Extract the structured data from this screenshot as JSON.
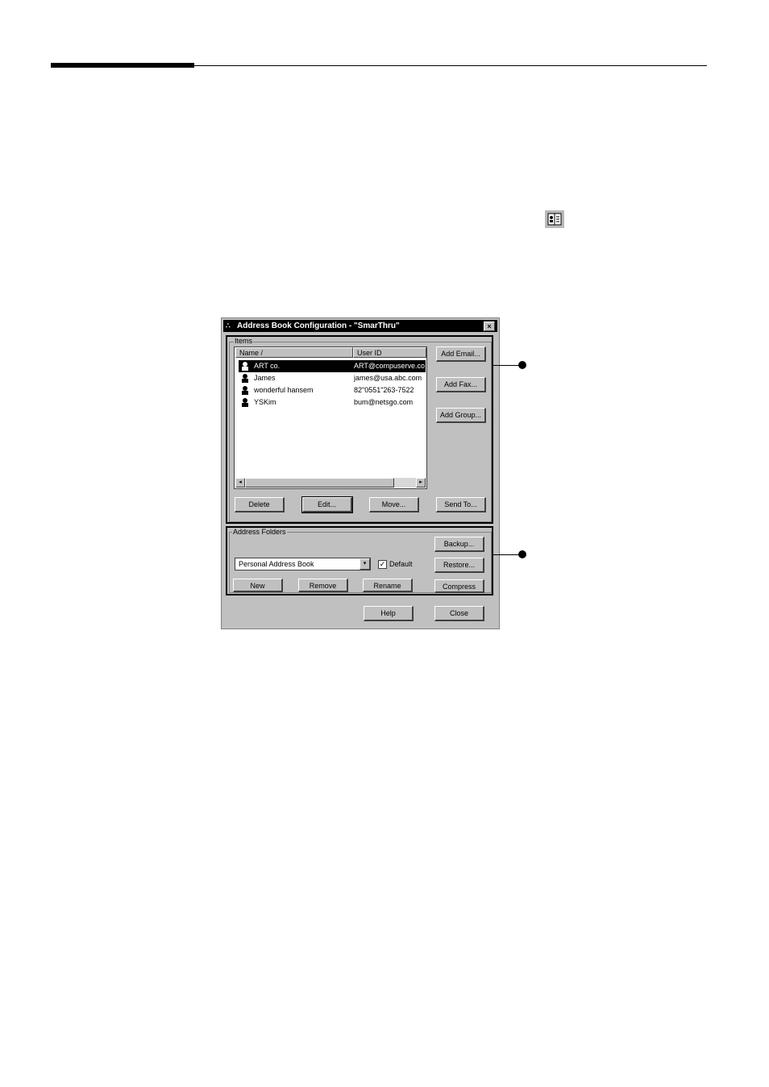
{
  "dialog": {
    "title": "Address Book Configuration - \"SmarThru\"",
    "title_icon": "app-icon",
    "close_label": "×"
  },
  "items_group": {
    "label": "Items",
    "columns": [
      "Name /",
      "User ID"
    ],
    "rows": [
      {
        "name": "ART co.",
        "user_id": "ART@compuserve.co",
        "selected": true
      },
      {
        "name": "James",
        "user_id": "james@usa.abc.com",
        "selected": false
      },
      {
        "name": "wonderful hansem",
        "user_id": "82\"0551\"263-7522",
        "selected": false
      },
      {
        "name": "YSKim",
        "user_id": "bum@netsgo.com",
        "selected": false
      }
    ],
    "buttons": {
      "add_email": "Add Email...",
      "add_fax": "Add Fax...",
      "add_group": "Add Group...",
      "delete": "Delete",
      "edit": "Edit...",
      "move": "Move...",
      "send_to": "Send To..."
    },
    "scroll_left": "◂",
    "scroll_right": "▸"
  },
  "folders_group": {
    "label": "Address Folders",
    "selected_folder": "Personal Address Book",
    "dropdown_arrow": "▾",
    "default_checked": true,
    "check_mark": "✓",
    "default_label": "Default",
    "buttons": {
      "backup": "Backup...",
      "restore": "Restore...",
      "compress": "Compress",
      "new": "New",
      "remove": "Remove",
      "rename": "Rename"
    }
  },
  "footer_buttons": {
    "help": "Help",
    "close": "Close"
  },
  "colors": {
    "dialog_face": "#c0c0c0",
    "title_bar": "#000000",
    "selection": "#000000"
  }
}
